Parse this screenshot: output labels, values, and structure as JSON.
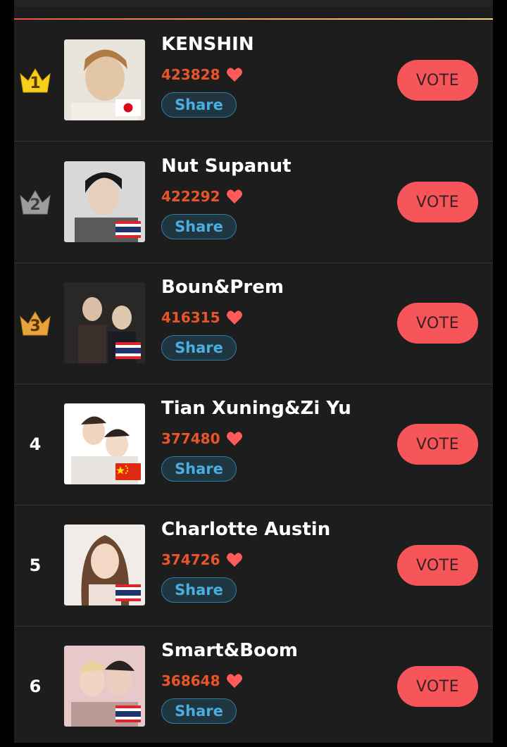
{
  "colors": {
    "panel_bg": "#1d1d1d",
    "vote_count": "#e8552a",
    "vote_button": "#f6555a",
    "share_text": "#4aaee0",
    "gold": "#f6cf1b",
    "silver": "#9d9d9d",
    "bronze": "#e8a43a"
  },
  "entries": [
    {
      "rank": "1",
      "name": "KENSHIN",
      "votes": "423828",
      "share_label": "Share",
      "vote_label": "VOTE",
      "flag": "japan",
      "crown": "gold",
      "heart_icon": "heart-icon"
    },
    {
      "rank": "2",
      "name": "Nut Supanut",
      "votes": "422292",
      "share_label": "Share",
      "vote_label": "VOTE",
      "flag": "thailand",
      "crown": "silver",
      "heart_icon": "heart-icon"
    },
    {
      "rank": "3",
      "name": "Boun&Prem",
      "votes": "416315",
      "share_label": "Share",
      "vote_label": "VOTE",
      "flag": "thailand",
      "crown": "bronze",
      "heart_icon": "heart-icon"
    },
    {
      "rank": "4",
      "name": "Tian Xuning&Zi Yu",
      "votes": "377480",
      "share_label": "Share",
      "vote_label": "VOTE",
      "flag": "china",
      "crown": "",
      "heart_icon": "heart-icon"
    },
    {
      "rank": "5",
      "name": "Charlotte Austin",
      "votes": "374726",
      "share_label": "Share",
      "vote_label": "VOTE",
      "flag": "thailand",
      "crown": "",
      "heart_icon": "heart-icon"
    },
    {
      "rank": "6",
      "name": "Smart&Boom",
      "votes": "368648",
      "share_label": "Share",
      "vote_label": "VOTE",
      "flag": "thailand",
      "crown": "",
      "heart_icon": "heart-icon"
    }
  ]
}
